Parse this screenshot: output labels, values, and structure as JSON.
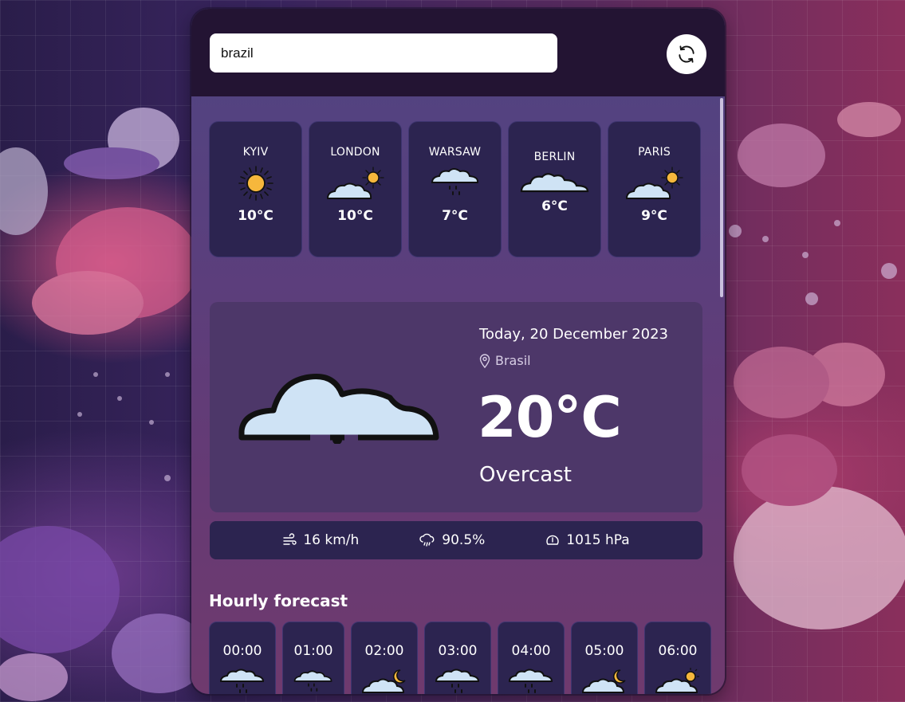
{
  "search": {
    "value": "brazil",
    "placeholder": ""
  },
  "cities": [
    {
      "name": "KYIV",
      "temp": "10°C",
      "icon": "sun-icon"
    },
    {
      "name": "LONDON",
      "temp": "10°C",
      "icon": "partly-cloudy-icon"
    },
    {
      "name": "WARSAW",
      "temp": "7°C",
      "icon": "rain-cloud-icon"
    },
    {
      "name": "BERLIN",
      "temp": "6°C",
      "icon": "cloud-icon"
    },
    {
      "name": "PARIS",
      "temp": "9°C",
      "icon": "partly-cloudy-icon"
    }
  ],
  "current": {
    "date": "Today, 20 December 2023",
    "location": "Brasil",
    "temperature": "20°C",
    "condition": "Overcast",
    "icon": "overcast-cloud-icon"
  },
  "stats": {
    "wind": "16 km/h",
    "humidity": "90.5%",
    "pressure": "1015 hPa"
  },
  "hourly": {
    "title": "Hourly forecast",
    "items": [
      {
        "time": "00:00",
        "icon": "rain-cloud-icon"
      },
      {
        "time": "01:00",
        "icon": "rain-cloud-icon"
      },
      {
        "time": "02:00",
        "icon": "cloudy-night-icon"
      },
      {
        "time": "03:00",
        "icon": "rain-cloud-icon"
      },
      {
        "time": "04:00",
        "icon": "rain-cloud-icon"
      },
      {
        "time": "05:00",
        "icon": "cloudy-night-icon"
      },
      {
        "time": "06:00",
        "icon": "partly-cloudy-icon"
      }
    ]
  },
  "colors": {
    "card": "#2c2450",
    "topbar": "#231433",
    "sun": "#f6b73c",
    "cloud": "#cfe3f5"
  }
}
